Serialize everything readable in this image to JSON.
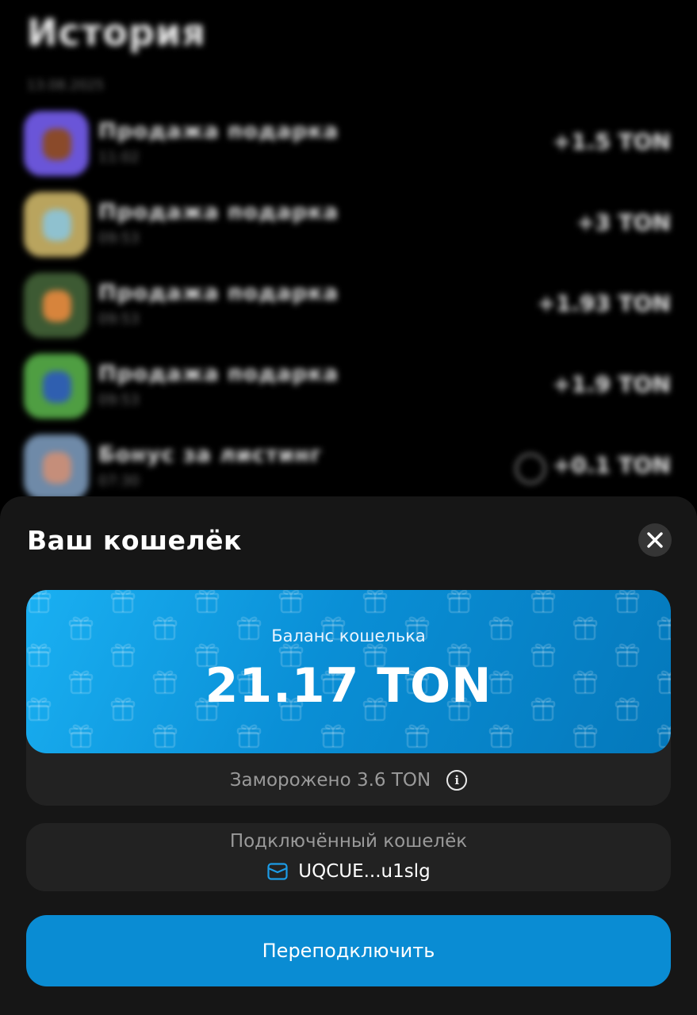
{
  "history": {
    "title": "История",
    "date": "13.08.2025",
    "items": [
      {
        "name": "Продажа подарка",
        "time": "11:02",
        "amount": "+1.5 TON",
        "thumb": "#6a55d8",
        "blob": "#8a4a2a"
      },
      {
        "name": "Продажа подарка",
        "time": "09:53",
        "amount": "+3 TON",
        "thumb": "#b9a45e",
        "blob": "#8fc1cf"
      },
      {
        "name": "Продажа подарка",
        "time": "09:53",
        "amount": "+1.93 TON",
        "thumb": "#3d5a33",
        "blob": "#d7843c"
      },
      {
        "name": "Продажа подарка",
        "time": "09:53",
        "amount": "+1.9 TON",
        "thumb": "#4f9e42",
        "blob": "#2f5fb0"
      },
      {
        "name": "Бонус за листинг",
        "time": "07:30",
        "amount": "+0.1 TON",
        "thumb": "#6f8aa8",
        "blob": "#c58e7a",
        "info": true
      }
    ]
  },
  "sheet": {
    "title": "Ваш кошелёк",
    "balance_label": "Баланс кошелька",
    "balance_value": "21.17 TON",
    "frozen": "Заморожено 3.6 TON",
    "wallet_label": "Подключённый кошелёк",
    "wallet_address": "UQCUE...u1slg",
    "reconnect_label": "Переподключить"
  },
  "colors": {
    "accent": "#0a8cd3",
    "sheet_bg": "#161616",
    "panel_bg": "#222222"
  },
  "icons": {
    "close": "close-icon",
    "info": "info-icon",
    "wallet": "wallet-icon",
    "gift_pattern": "gift-icon"
  }
}
